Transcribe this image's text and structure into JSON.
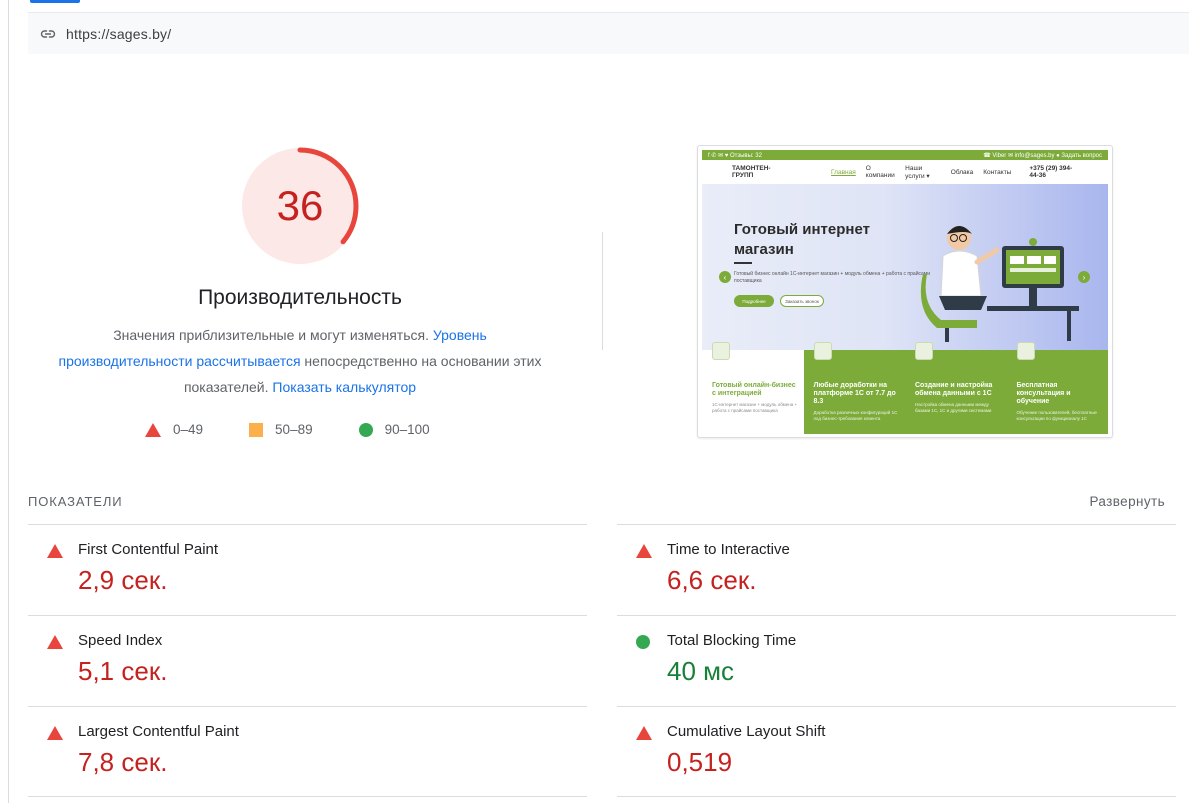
{
  "url_bar": {
    "url": "https://sages.by/",
    "icon": "link-icon"
  },
  "performance": {
    "score": "36",
    "score_value": 36,
    "score_color": "#c5221f",
    "title": "Производительность",
    "desc_text_1": "Значения приблизительные и могут изменяться. ",
    "desc_link_1": "Уровень производительности рассчитывается",
    "desc_text_2": " непосредственно на основании этих показателей. ",
    "desc_link_2": "Показать калькулятор"
  },
  "legend": [
    {
      "icon": "triangle-red",
      "label": "0–49"
    },
    {
      "icon": "square-orange",
      "label": "50–89"
    },
    {
      "icon": "circle-green",
      "label": "90–100"
    }
  ],
  "thumbnail": {
    "topbar_left": "f  ✆  ✉  ♥   Отзывы: 32",
    "topbar_right": "☎ Viber  ✉ info@sages.by  ● Задать вопрос",
    "logo": "ТАМОНТЕН-ГРУПП",
    "nav_links": [
      "Главная",
      "О компании",
      "Наши услуги ▾",
      "Облака",
      "Контакты"
    ],
    "phone": "+375 (29) 394-44-36",
    "hero_title": "Готовый интернет магазин",
    "hero_sub": "Готовый бизнес онлайн 1С-интернет магазин + модуль обмена + работа с прайсами поставщика",
    "btn_primary": "Подробнее",
    "btn_secondary": "Заказать звонок",
    "cards": [
      {
        "title": "Готовый онлайн-бизнес с интеграцией",
        "text": "1С-интернет магазин + модуль обмена + работа с прайсами поставщика"
      },
      {
        "title": "Любые доработки на платформе 1С от 7.7 до 8.3",
        "text": "Доработка различных конфигураций 1С под бизнес-требования клиента"
      },
      {
        "title": "Создание и настройка обмена данными с 1С",
        "text": "Настройка обмена данными между базами 1С, 1С и другими системами"
      },
      {
        "title": "Бесплатная консультация и обучение",
        "text": "Обучение пользователей, бесплатные консультации по функционалу 1С"
      }
    ]
  },
  "metrics": {
    "header": "ПОКАЗАТЕЛИ",
    "expand_label": "Развернуть",
    "items": [
      {
        "label": "First Contentful Paint",
        "value": "2,9 сек.",
        "status": "bad"
      },
      {
        "label": "Time to Interactive",
        "value": "6,6 сек.",
        "status": "bad"
      },
      {
        "label": "Speed Index",
        "value": "5,1 сек.",
        "status": "bad"
      },
      {
        "label": "Total Blocking Time",
        "value": "40 мс",
        "status": "good"
      },
      {
        "label": "Largest Contentful Paint",
        "value": "7,8 сек.",
        "status": "bad"
      },
      {
        "label": "Cumulative Layout Shift",
        "value": "0,519",
        "status": "bad"
      }
    ]
  },
  "colors": {
    "bad": "#c5221f",
    "good": "#188038",
    "link": "#1a73e8",
    "gauge_arc": "#e8453c",
    "gauge_bg": "#fce8e6"
  }
}
